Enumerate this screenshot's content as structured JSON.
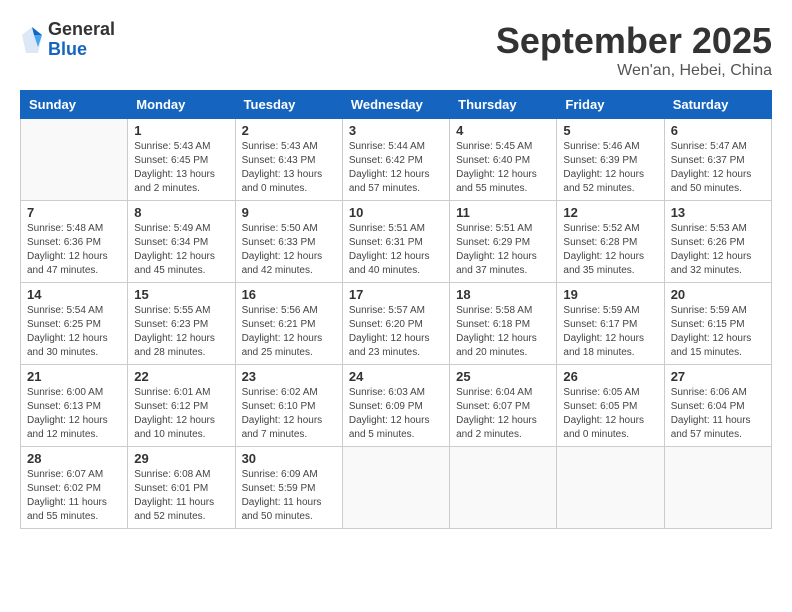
{
  "header": {
    "logo": {
      "general": "General",
      "blue": "Blue"
    },
    "title": "September 2025",
    "location": "Wen'an, Hebei, China"
  },
  "weekdays": [
    "Sunday",
    "Monday",
    "Tuesday",
    "Wednesday",
    "Thursday",
    "Friday",
    "Saturday"
  ],
  "weeks": [
    [
      {
        "day": "",
        "info": ""
      },
      {
        "day": "1",
        "info": "Sunrise: 5:43 AM\nSunset: 6:45 PM\nDaylight: 13 hours\nand 2 minutes."
      },
      {
        "day": "2",
        "info": "Sunrise: 5:43 AM\nSunset: 6:43 PM\nDaylight: 13 hours\nand 0 minutes."
      },
      {
        "day": "3",
        "info": "Sunrise: 5:44 AM\nSunset: 6:42 PM\nDaylight: 12 hours\nand 57 minutes."
      },
      {
        "day": "4",
        "info": "Sunrise: 5:45 AM\nSunset: 6:40 PM\nDaylight: 12 hours\nand 55 minutes."
      },
      {
        "day": "5",
        "info": "Sunrise: 5:46 AM\nSunset: 6:39 PM\nDaylight: 12 hours\nand 52 minutes."
      },
      {
        "day": "6",
        "info": "Sunrise: 5:47 AM\nSunset: 6:37 PM\nDaylight: 12 hours\nand 50 minutes."
      }
    ],
    [
      {
        "day": "7",
        "info": "Sunrise: 5:48 AM\nSunset: 6:36 PM\nDaylight: 12 hours\nand 47 minutes."
      },
      {
        "day": "8",
        "info": "Sunrise: 5:49 AM\nSunset: 6:34 PM\nDaylight: 12 hours\nand 45 minutes."
      },
      {
        "day": "9",
        "info": "Sunrise: 5:50 AM\nSunset: 6:33 PM\nDaylight: 12 hours\nand 42 minutes."
      },
      {
        "day": "10",
        "info": "Sunrise: 5:51 AM\nSunset: 6:31 PM\nDaylight: 12 hours\nand 40 minutes."
      },
      {
        "day": "11",
        "info": "Sunrise: 5:51 AM\nSunset: 6:29 PM\nDaylight: 12 hours\nand 37 minutes."
      },
      {
        "day": "12",
        "info": "Sunrise: 5:52 AM\nSunset: 6:28 PM\nDaylight: 12 hours\nand 35 minutes."
      },
      {
        "day": "13",
        "info": "Sunrise: 5:53 AM\nSunset: 6:26 PM\nDaylight: 12 hours\nand 32 minutes."
      }
    ],
    [
      {
        "day": "14",
        "info": "Sunrise: 5:54 AM\nSunset: 6:25 PM\nDaylight: 12 hours\nand 30 minutes."
      },
      {
        "day": "15",
        "info": "Sunrise: 5:55 AM\nSunset: 6:23 PM\nDaylight: 12 hours\nand 28 minutes."
      },
      {
        "day": "16",
        "info": "Sunrise: 5:56 AM\nSunset: 6:21 PM\nDaylight: 12 hours\nand 25 minutes."
      },
      {
        "day": "17",
        "info": "Sunrise: 5:57 AM\nSunset: 6:20 PM\nDaylight: 12 hours\nand 23 minutes."
      },
      {
        "day": "18",
        "info": "Sunrise: 5:58 AM\nSunset: 6:18 PM\nDaylight: 12 hours\nand 20 minutes."
      },
      {
        "day": "19",
        "info": "Sunrise: 5:59 AM\nSunset: 6:17 PM\nDaylight: 12 hours\nand 18 minutes."
      },
      {
        "day": "20",
        "info": "Sunrise: 5:59 AM\nSunset: 6:15 PM\nDaylight: 12 hours\nand 15 minutes."
      }
    ],
    [
      {
        "day": "21",
        "info": "Sunrise: 6:00 AM\nSunset: 6:13 PM\nDaylight: 12 hours\nand 12 minutes."
      },
      {
        "day": "22",
        "info": "Sunrise: 6:01 AM\nSunset: 6:12 PM\nDaylight: 12 hours\nand 10 minutes."
      },
      {
        "day": "23",
        "info": "Sunrise: 6:02 AM\nSunset: 6:10 PM\nDaylight: 12 hours\nand 7 minutes."
      },
      {
        "day": "24",
        "info": "Sunrise: 6:03 AM\nSunset: 6:09 PM\nDaylight: 12 hours\nand 5 minutes."
      },
      {
        "day": "25",
        "info": "Sunrise: 6:04 AM\nSunset: 6:07 PM\nDaylight: 12 hours\nand 2 minutes."
      },
      {
        "day": "26",
        "info": "Sunrise: 6:05 AM\nSunset: 6:05 PM\nDaylight: 12 hours\nand 0 minutes."
      },
      {
        "day": "27",
        "info": "Sunrise: 6:06 AM\nSunset: 6:04 PM\nDaylight: 11 hours\nand 57 minutes."
      }
    ],
    [
      {
        "day": "28",
        "info": "Sunrise: 6:07 AM\nSunset: 6:02 PM\nDaylight: 11 hours\nand 55 minutes."
      },
      {
        "day": "29",
        "info": "Sunrise: 6:08 AM\nSunset: 6:01 PM\nDaylight: 11 hours\nand 52 minutes."
      },
      {
        "day": "30",
        "info": "Sunrise: 6:09 AM\nSunset: 5:59 PM\nDaylight: 11 hours\nand 50 minutes."
      },
      {
        "day": "",
        "info": ""
      },
      {
        "day": "",
        "info": ""
      },
      {
        "day": "",
        "info": ""
      },
      {
        "day": "",
        "info": ""
      }
    ]
  ]
}
